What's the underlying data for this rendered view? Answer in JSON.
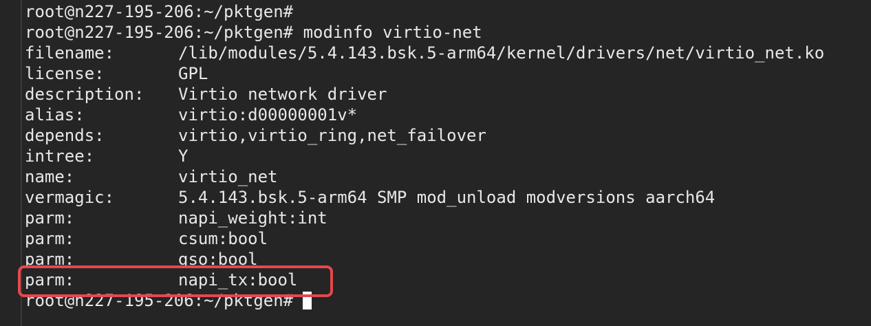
{
  "terminal": {
    "lines": [
      {
        "text": "root@n227-195-206:~/pktgen#"
      },
      {
        "text": "root@n227-195-206:~/pktgen# modinfo virtio-net"
      },
      {
        "key": "filename:",
        "value": "/lib/modules/5.4.143.bsk.5-arm64/kernel/drivers/net/virtio_net.ko"
      },
      {
        "key": "license:",
        "value": "GPL"
      },
      {
        "key": "description:",
        "value": "Virtio network driver"
      },
      {
        "key": "alias:",
        "value": "virtio:d00000001v*"
      },
      {
        "key": "depends:",
        "value": "virtio,virtio_ring,net_failover"
      },
      {
        "key": "intree:",
        "value": "Y"
      },
      {
        "key": "name:",
        "value": "virtio_net"
      },
      {
        "key": "vermagic:",
        "value": "5.4.143.bsk.5-arm64 SMP mod_unload modversions aarch64"
      },
      {
        "key": "parm:",
        "value": "napi_weight:int"
      },
      {
        "key": "parm:",
        "value": "csum:bool"
      },
      {
        "key": "parm:",
        "value": "gso:bool"
      },
      {
        "key": "parm:",
        "value": "napi_tx:bool"
      }
    ],
    "final_prompt": "root@n227-195-206:~/pktgen#"
  },
  "highlight": {
    "color": "#e5484d",
    "target_line": "parm: napi_tx:bool"
  }
}
